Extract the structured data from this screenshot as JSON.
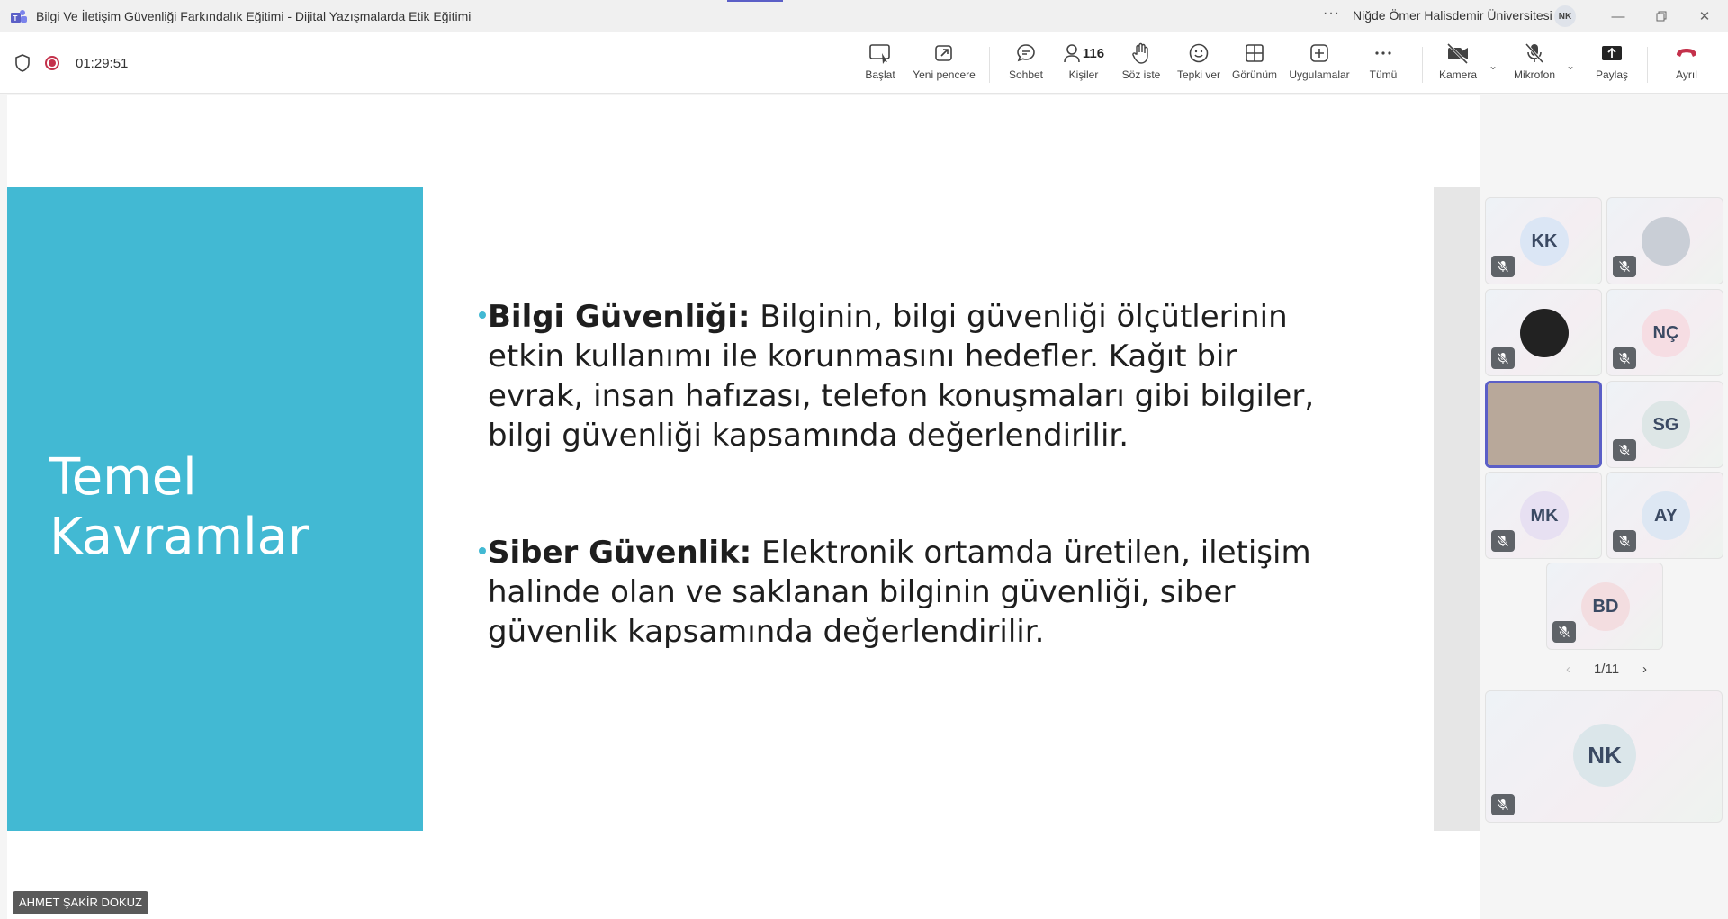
{
  "window": {
    "title": "Bilgi Ve İletişim Güvenliği Farkındalık Eğitimi - Dijital Yazışmalarda Etik Eğitimi",
    "more": "···",
    "organization": "Niğde Ömer Halisdemir Üniversitesi",
    "account_initials": "NK"
  },
  "meeting": {
    "timer": "01:29:51"
  },
  "toolbar": {
    "start_label": "Başlat",
    "new_window_label": "Yeni pencere",
    "chat_label": "Sohbet",
    "people_label": "Kişiler",
    "people_count": "116",
    "raise_hand_label": "Söz iste",
    "react_label": "Tepki ver",
    "view_label": "Görünüm",
    "apps_label": "Uygulamalar",
    "more_label": "Tümü",
    "camera_label": "Kamera",
    "mic_label": "Mikrofon",
    "share_label": "Paylaş",
    "leave_label": "Ayrıl"
  },
  "slide": {
    "heading_line1": "Temel",
    "heading_line2": "Kavramlar",
    "bullets": [
      {
        "term": "Bilgi Güvenliği:",
        "text": " Bilginin, bilgi güvenliği ölçütlerinin etkin kullanımı ile korunmasını hedefler. Kağıt bir evrak, insan hafızası, telefon konuşmaları gibi bilgiler, bilgi güvenliği kapsamında değerlendirilir."
      },
      {
        "term": "Siber Güvenlik:",
        "text": " Elektronik ortamda üretilen, iletişim halinde olan ve saklanan bilginin güvenliği, siber güvenlik kapsamında değerlendirilir."
      }
    ]
  },
  "presenter": {
    "name": "AHMET ŞAKİR DOKUZ"
  },
  "participants": {
    "tiles": [
      {
        "initials": "KK",
        "color": "#dbe6f5"
      },
      {
        "initials": "",
        "color": "#c9ced6"
      },
      {
        "initials": "",
        "color": "#222222"
      },
      {
        "initials": "NÇ",
        "color": "#f6dde3"
      },
      {
        "initials": "",
        "color": "#b8a89a"
      },
      {
        "initials": "SG",
        "color": "#dde6e6"
      },
      {
        "initials": "MK",
        "color": "#e7e0f2"
      },
      {
        "initials": "AY",
        "color": "#dde7f3"
      },
      {
        "initials": "BD",
        "color": "#f3dde0"
      }
    ],
    "pager": "1/11",
    "self_initials": "NK",
    "self_color": "#dbe6ea"
  },
  "colors": {
    "accent": "#5b5fc7",
    "slide_panel": "#42b9d3",
    "leave": "#c4314b"
  }
}
